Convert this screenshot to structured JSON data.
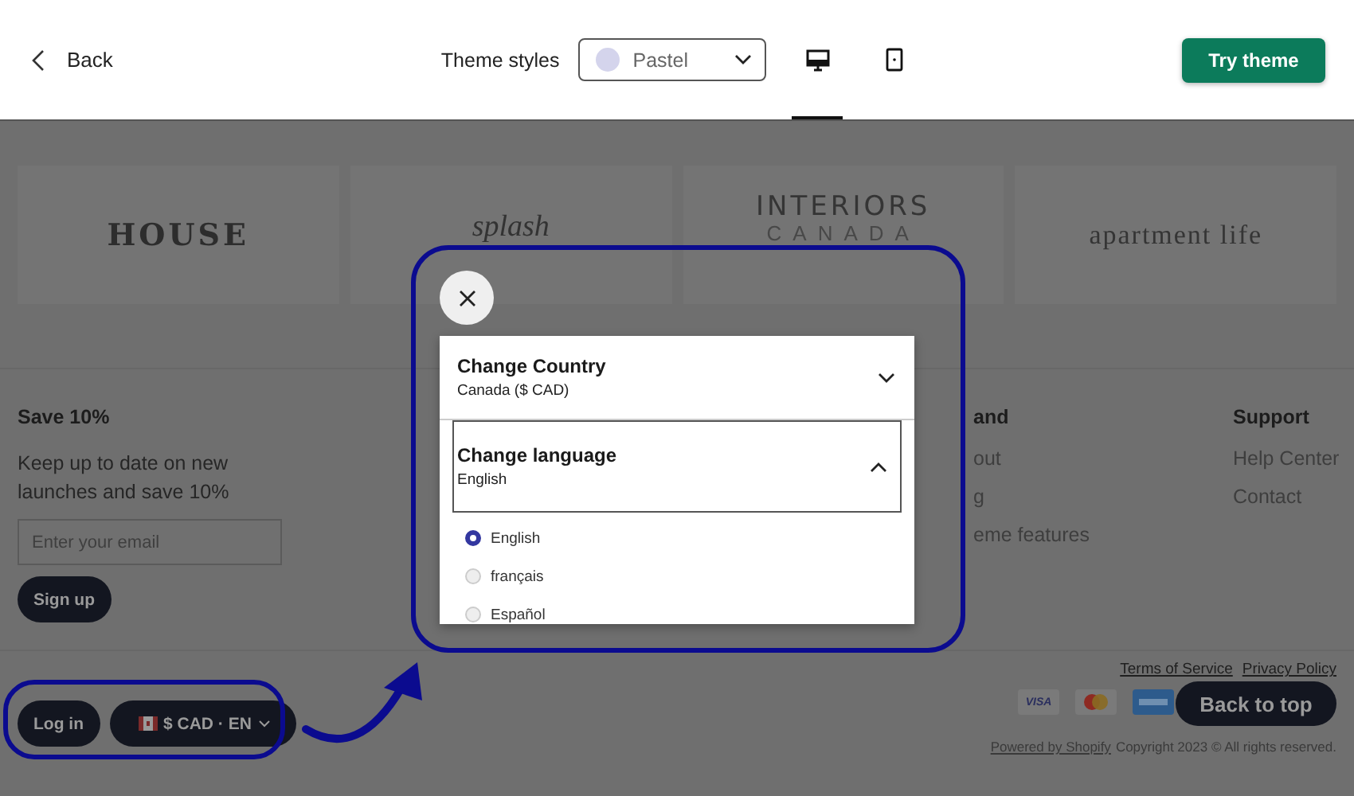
{
  "top_bar": {
    "back": "Back",
    "theme_label": "Theme styles",
    "theme_select": {
      "value": "Pastel",
      "color": "#d4d4ec"
    },
    "view_modes": [
      {
        "kind": "desktop",
        "selected": true
      },
      {
        "kind": "tablet",
        "selected": false
      }
    ],
    "try_button": "Try theme"
  },
  "logos": [
    {
      "kind": "serif-caps",
      "text": "HOUSE"
    },
    {
      "kind": "script",
      "text": "splash"
    },
    {
      "kind": "stacked",
      "text": "INTERIORS",
      "subtext": "CANADA"
    },
    {
      "kind": "serif",
      "text": "apartment life"
    }
  ],
  "newsletter": {
    "heading": "Save 10%",
    "text": "Keep up to date on new launches and save 10%",
    "email": {
      "placeholder": "Enter your email"
    },
    "button": "Sign up"
  },
  "footer_columns": [
    {
      "heading": "and",
      "links": [
        "out",
        "g",
        "eme features"
      ]
    },
    {
      "heading": "Support",
      "links": [
        "Help Center",
        "Contact"
      ]
    }
  ],
  "bottom_bar": {
    "login": "Log in",
    "currency": "$ CAD · EN",
    "legal_links": [
      "Terms of Service",
      "Privacy Policy"
    ],
    "payment_icons": [
      {
        "kind": "visa",
        "label": "VISA"
      },
      {
        "kind": "mastercard"
      },
      {
        "kind": "amex"
      }
    ],
    "powered": "Powered by Shopify",
    "copyright": "Copyright 2023 © All rights reserved.",
    "back_to_top": "Back to top"
  },
  "modal": {
    "sections": [
      {
        "title": "Change Country",
        "value": "Canada ($ CAD)",
        "expanded": false
      },
      {
        "title": "Change language",
        "value": "English",
        "expanded": true,
        "options": [
          {
            "label": "English",
            "selected": true
          },
          {
            "label": "français",
            "selected": false
          },
          {
            "label": "Español",
            "selected": false
          }
        ]
      }
    ]
  }
}
